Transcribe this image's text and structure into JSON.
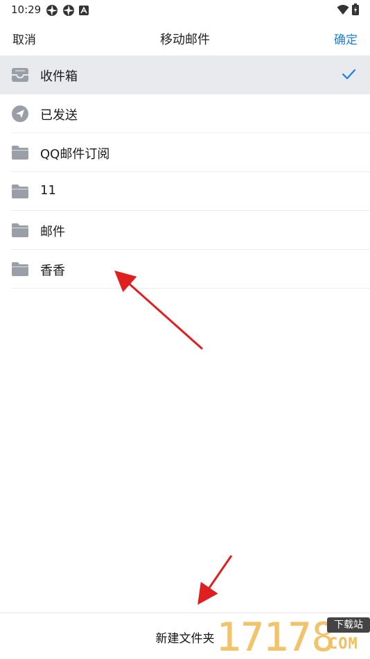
{
  "status_bar": {
    "time": "10:29",
    "left_icons": [
      "aperture-icon",
      "aperture-icon",
      "app-a-icon"
    ],
    "right_icons": [
      "wifi-icon",
      "battery-icon"
    ]
  },
  "nav": {
    "cancel_label": "取消",
    "title": "移动邮件",
    "confirm_label": "确定"
  },
  "folders": [
    {
      "label": "收件箱",
      "icon": "inbox-icon",
      "selected": true
    },
    {
      "label": "已发送",
      "icon": "sent-icon",
      "selected": false
    },
    {
      "label": "QQ邮件订阅",
      "icon": "folder-icon",
      "selected": false
    },
    {
      "label": "11",
      "icon": "folder-icon",
      "selected": false
    },
    {
      "label": "邮件",
      "icon": "folder-icon",
      "selected": false
    },
    {
      "label": "香香",
      "icon": "folder-icon",
      "selected": false
    }
  ],
  "bottom": {
    "new_folder_label": "新建文件夹"
  },
  "watermark": {
    "digits": "17178",
    "badge": "下载站",
    "suffix": "COM"
  },
  "colors": {
    "accent": "#1a7fe0",
    "selected_row_bg": "#e9eaee",
    "icon_gray": "#9a9ea6",
    "annotation_red": "#e02020"
  }
}
